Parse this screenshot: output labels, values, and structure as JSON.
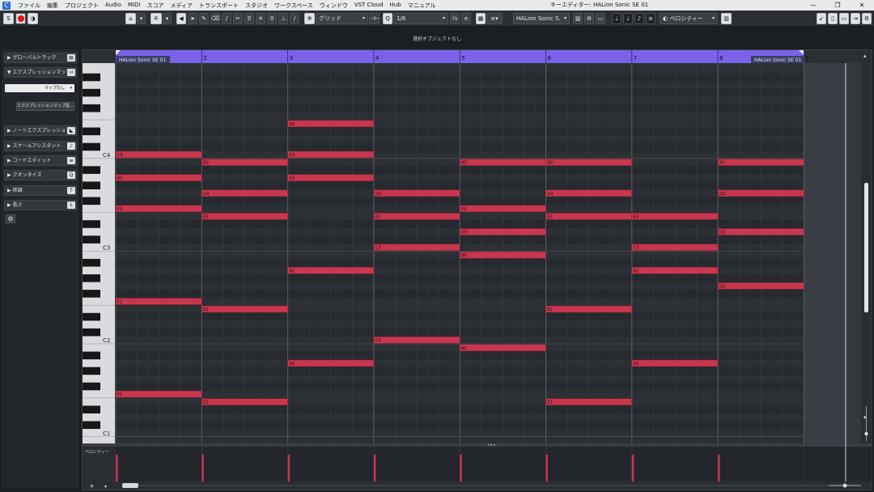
{
  "menubar": {
    "items": [
      "ファイル",
      "編集",
      "プロジェクト",
      "Audio",
      "MIDI",
      "スコア",
      "メディア",
      "トランスポート",
      "スタジオ",
      "ワークスペース",
      "ウィンドウ",
      "VST Cloud",
      "Hub",
      "マニュアル"
    ],
    "window_title": "キーエディター: HALion Sonic SE 01",
    "controls": [
      "—",
      "❐",
      "✕"
    ]
  },
  "toolbar": {
    "grid_type": "グリッド",
    "quantize_value": "1/8",
    "instrument": "HALion Sonic S.",
    "controller_lane": "ベロシティー",
    "solo_label": "S",
    "listen_label": "◑"
  },
  "info_line": "選択オブジェクトなし",
  "inspector": {
    "sections": [
      {
        "label": "▶ グローバルトラック",
        "icon": "▤"
      },
      {
        "label": "▼ エクスプレッションマップ",
        "icon": "♭♯"
      },
      {
        "label": "▶ ノートエクスプレッション",
        "icon": "◣"
      },
      {
        "label": "▶ スケールアシスタント",
        "icon": "♪"
      },
      {
        "label": "▶ コードエディット",
        "icon": "≡"
      },
      {
        "label": "▶ クオンタイズ",
        "icon": "Q"
      },
      {
        "label": "▶ 移調",
        "icon": "T"
      },
      {
        "label": "▶ 長さ",
        "icon": "L"
      }
    ],
    "expression_map_value": "マップなし",
    "expression_map_button": "エクスプレッションマップ設..."
  },
  "ruler": {
    "bars": [
      "1",
      "2",
      "3",
      "4",
      "5",
      "6",
      "7",
      "8",
      "9"
    ],
    "part_name_start": "HALion Sonic SE 01",
    "part_name_end": "HALion Sonic SE 01"
  },
  "keyboard": {
    "octave_labels": [
      "C4",
      "C3",
      "C2",
      "C1"
    ]
  },
  "notes": [
    {
      "pitch": "C4",
      "bar": 1,
      "len": 1
    },
    {
      "pitch": "A3",
      "bar": 1,
      "len": 1
    },
    {
      "pitch": "F3",
      "bar": 1,
      "len": 1
    },
    {
      "pitch": "F2",
      "bar": 1,
      "len": 1
    },
    {
      "pitch": "F1",
      "bar": 1,
      "len": 1
    },
    {
      "pitch": "B3",
      "bar": 2,
      "len": 1
    },
    {
      "pitch": "G3",
      "bar": 2,
      "len": 1
    },
    {
      "pitch": "E3",
      "bar": 2,
      "len": 1
    },
    {
      "pitch": "E2",
      "bar": 2,
      "len": 1
    },
    {
      "pitch": "E1",
      "bar": 2,
      "len": 1
    },
    {
      "pitch": "E4",
      "bar": 3,
      "len": 1
    },
    {
      "pitch": "C4",
      "bar": 3,
      "len": 1
    },
    {
      "pitch": "A3",
      "bar": 3,
      "len": 1
    },
    {
      "pitch": "A2",
      "bar": 3,
      "len": 1
    },
    {
      "pitch": "A1",
      "bar": 3,
      "len": 1
    },
    {
      "pitch": "G3",
      "bar": 4,
      "len": 1
    },
    {
      "pitch": "E3",
      "bar": 4,
      "len": 1
    },
    {
      "pitch": "C3",
      "bar": 4,
      "len": 1
    },
    {
      "pitch": "C2",
      "bar": 4,
      "len": 1
    },
    {
      "pitch": "B3",
      "bar": 5,
      "len": 1
    },
    {
      "pitch": "F3",
      "bar": 5,
      "len": 1
    },
    {
      "pitch": "D3",
      "bar": 5,
      "len": 1
    },
    {
      "pitch": "B2",
      "bar": 5,
      "len": 1
    },
    {
      "pitch": "B1",
      "bar": 5,
      "len": 1
    },
    {
      "pitch": "B3",
      "bar": 6,
      "len": 1
    },
    {
      "pitch": "G3",
      "bar": 6,
      "len": 1
    },
    {
      "pitch": "E3",
      "bar": 6,
      "len": 1
    },
    {
      "pitch": "E2",
      "bar": 6,
      "len": 1
    },
    {
      "pitch": "E1",
      "bar": 6,
      "len": 1
    },
    {
      "pitch": "E3",
      "bar": 7,
      "len": 1
    },
    {
      "pitch": "C3",
      "bar": 7,
      "len": 1
    },
    {
      "pitch": "A2",
      "bar": 7,
      "len": 1
    },
    {
      "pitch": "A1",
      "bar": 7,
      "len": 1
    },
    {
      "pitch": "B3",
      "bar": 8,
      "len": 1
    },
    {
      "pitch": "G3",
      "bar": 8,
      "len": 1
    },
    {
      "pitch": "D3",
      "bar": 8,
      "len": 1
    },
    {
      "pitch": "G2",
      "bar": 8,
      "len": 1
    }
  ],
  "controller": {
    "lane_label": "ベロシティー",
    "velocity_bars": [
      1,
      2,
      3,
      4,
      5,
      6,
      7,
      8
    ]
  },
  "colors": {
    "note": "#c8364f",
    "ruler": "#7a63e8",
    "velocity": "#c8364f"
  }
}
